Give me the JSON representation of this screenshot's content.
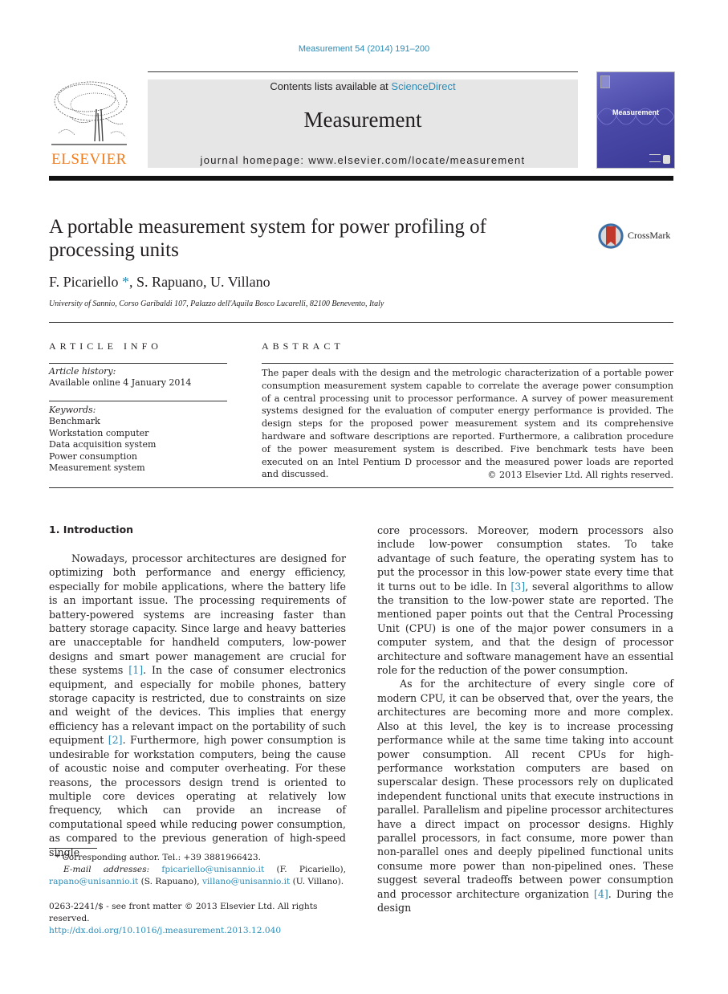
{
  "header": {
    "journal_ref": "Measurement 54 (2014) 191–200",
    "contents_prefix": "Contents lists available at ",
    "contents_link": "ScienceDirect",
    "journal_name": "Measurement",
    "homepage": "journal homepage: www.elsevier.com/locate/measurement",
    "publisher_logo_text": "ELSEVIER",
    "cover_title": "Measurement",
    "brand_colors": {
      "link": "#2a8cb8",
      "elsevier_orange": "#f07d1e",
      "cover_purple": "#4a49a8"
    }
  },
  "article": {
    "title": "A portable measurement system for power profiling of processing units",
    "crossmark_label": "CrossMark",
    "authors": [
      {
        "name": "F. Picariello",
        "corresponding_mark": "*"
      },
      {
        "name": "S. Rapuano"
      },
      {
        "name": "U. Villano"
      }
    ],
    "affiliation": "University of Sannio, Corso Garibaldi 107, Palazzo dell'Aquila Bosco Lucarelli, 82100 Benevento, Italy"
  },
  "article_info": {
    "heading": "ARTICLE INFO",
    "history_label": "Article history:",
    "history_value": "Available online 4 January 2014",
    "keywords_label": "Keywords:",
    "keywords": [
      "Benchmark",
      "Workstation computer",
      "Data acquisition system",
      "Power consumption",
      "Measurement system"
    ]
  },
  "abstract": {
    "heading": "ABSTRACT",
    "text": "The paper deals with the design and the metrologic characterization of a portable power consumption measurement system capable to correlate the average power consumption of a central processing unit to processor performance. A survey of power measurement systems designed for the evaluation of computer energy performance is provided. The design steps for the proposed power measurement system and its comprehensive hardware and software descriptions are reported. Furthermore, a calibration procedure of the power measurement system is described. Five benchmark tests have been executed on an Intel Pentium D processor and the measured power loads are reported and discussed.",
    "copyright": "© 2013 Elsevier Ltd. All rights reserved."
  },
  "body": {
    "section_heading": "1. Introduction",
    "left_p1_a": "Nowadays, processor architectures are designed for optimizing both performance and energy efficiency, especially for mobile applications, where the battery life is an important issue. The processing requirements of battery-powered systems are increasing faster than battery storage capacity. Since large and heavy batteries are unacceptable for handheld computers, low-power designs and smart power management are crucial for these systems ",
    "ref1": "[1]",
    "left_p1_b": ". In the case of consumer electronics equipment, and especially for mobile phones, battery storage capacity is restricted, due to constraints on size and weight of the devices. This implies that energy efficiency has a relevant impact on the portability of such equipment ",
    "ref2": "[2]",
    "left_p1_c": ". Furthermore, high power consumption is undesirable for workstation computers, being the cause of acoustic noise and computer overheating. For these reasons, the processors design trend is oriented to multiple core devices operating at relatively low frequency, which can provide an increase of computational speed while reducing power consumption, as compared to the previous generation of high-speed single",
    "right_p1_a": "core processors. Moreover, modern processors also include low-power consumption states. To take advantage of such feature, the operating system has to put the processor in this low-power state every time that it turns out to be idle. In ",
    "ref3": "[3]",
    "right_p1_b": ", several algorithms to allow the transition to the low-power state are reported. The mentioned paper points out that the Central Processing Unit (CPU) is one of the major power consumers in a computer system, and that the design of processor architecture and software management have an essential role for the reduction of the power consumption.",
    "right_p2_a": "As for the architecture of every single core of modern CPU, it can be observed that, over the years, the architectures are becoming more and more complex. Also at this level, the key is to increase processing performance while at the same time taking into account power consumption. All recent CPUs for high-performance workstation computers are based on superscalar design. These processors rely on duplicated independent functional units that execute instructions in parallel. Parallelism and pipeline processor architectures have a direct impact on processor designs. Highly parallel processors, in fact consume, more power than non-parallel ones and deeply pipelined functional units consume more power than non-pipelined ones. These suggest several tradeoffs between power consumption and processor architecture organization ",
    "ref4": "[4]",
    "right_p2_b": ". During the design"
  },
  "footnotes": {
    "corresponding": "* Corresponding author. Tel.: +39 3881966423.",
    "email_label": "E-mail addresses:",
    "email1": "fpicariello@unisannio.it",
    "email1_owner": " (F. Picariello), ",
    "email2": "rapano@unisannio.it",
    "email2_owner": " (S. Rapuano), ",
    "email3": "villano@unisannio.it",
    "email3_owner": " (U. Villano).",
    "issn_line": "0263-2241/$ - see front matter © 2013 Elsevier Ltd. All rights reserved.",
    "doi": "http://dx.doi.org/10.1016/j.measurement.2013.12.040"
  }
}
